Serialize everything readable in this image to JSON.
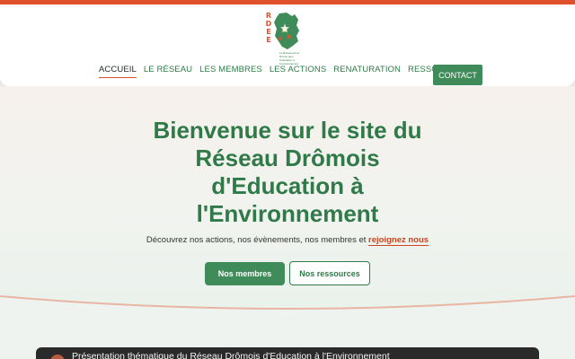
{
  "logo": {
    "letters": [
      "R",
      "D",
      "E",
      "E"
    ],
    "caption": "Le Réseau de la Drôme pour l'éducation à l'environnement",
    "colors": {
      "map": "#3f8c5a",
      "letters": "#e0522b"
    }
  },
  "nav": {
    "items": [
      "ACCUEIL",
      "LE RÉSEAU",
      "LES MEMBRES",
      "LES ACTIONS",
      "RENATURATION",
      "RESSOURCES"
    ],
    "active": "ACCUEIL",
    "contact_label": "CONTACT"
  },
  "hero": {
    "title": "Bienvenue sur le site du Réseau Drômois d'Education à l'Environnement",
    "subtitle_prefix": "Découvrez nos actions, nos évènements, nos membres et",
    "subtitle_link": "rejoignez nous",
    "primary_button": "Nos membres",
    "secondary_button": "Nos ressources"
  },
  "video": {
    "title": "Présentation thématique du Réseau Drômois d'Education à l'Environnement"
  },
  "colors": {
    "accent": "#e0522b",
    "brand_green": "#3f8c5a",
    "title_green": "#2f7a48"
  }
}
